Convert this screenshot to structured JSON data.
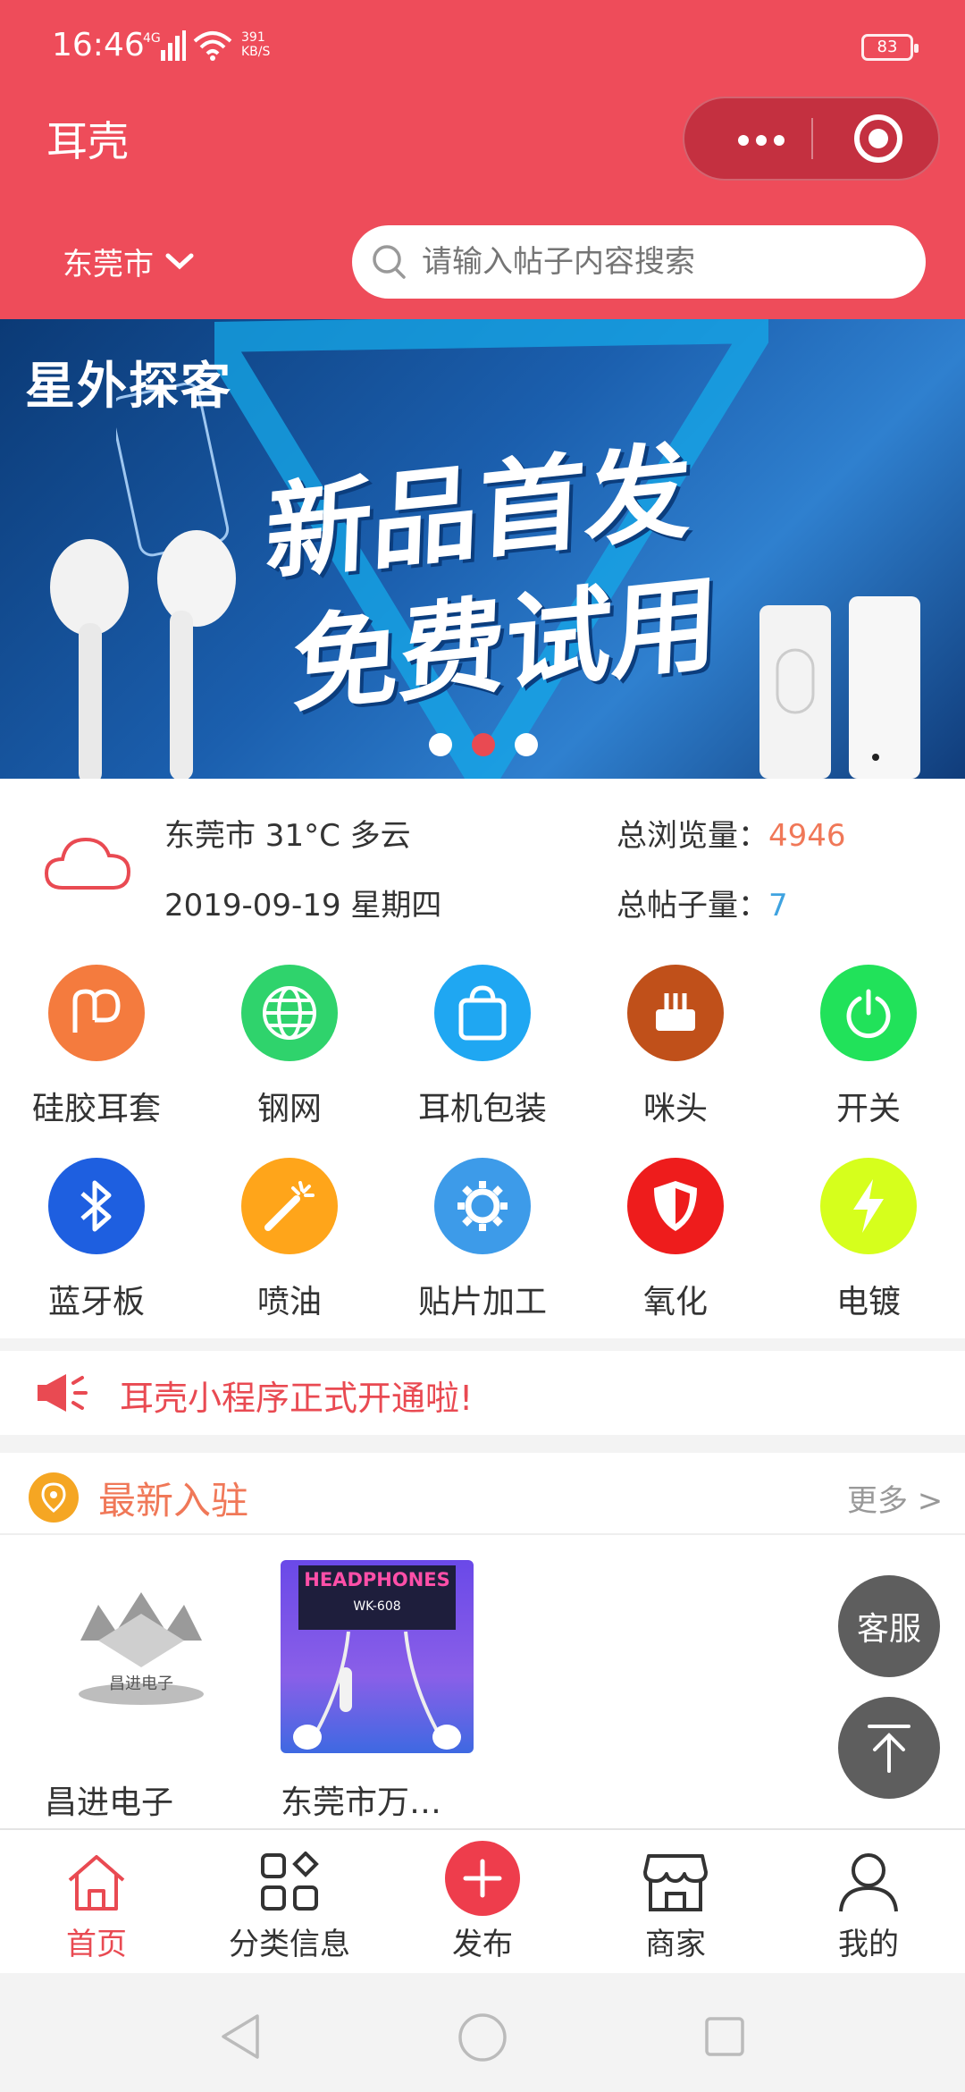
{
  "status_bar": {
    "time": "16:46",
    "network": "4G",
    "speed_value": "391",
    "speed_unit": "KB/S",
    "battery": "83"
  },
  "header": {
    "title": "耳壳",
    "city": "东莞市",
    "search_placeholder": "请输入帖子内容搜索"
  },
  "banner": {
    "brand": "星外探客",
    "headline_1": "新品首发",
    "headline_2": "免费试用",
    "active_dot": 1,
    "dot_count": 3
  },
  "info": {
    "weather": "东莞市 31°C 多云",
    "date": "2019-09-19 星期四",
    "views_label": "总浏览量：",
    "views_value": "4946",
    "posts_label": "总帖子量：",
    "posts_value": "7"
  },
  "categories": [
    {
      "label": "硅胶耳套",
      "icon": "earpad-icon",
      "color": "#f47b3e"
    },
    {
      "label": "钢网",
      "icon": "globe-icon",
      "color": "#2fd36c"
    },
    {
      "label": "耳机包装",
      "icon": "shopping-bag-icon",
      "color": "#1fa7f2"
    },
    {
      "label": "咪头",
      "icon": "router-icon",
      "color": "#c0501a"
    },
    {
      "label": "开关",
      "icon": "power-icon",
      "color": "#21e25a"
    },
    {
      "label": "蓝牙板",
      "icon": "bluetooth-icon",
      "color": "#1e5fe0"
    },
    {
      "label": "喷油",
      "icon": "magic-wand-icon",
      "color": "#ffa51a"
    },
    {
      "label": "贴片加工",
      "icon": "gear-icon",
      "color": "#3d9be9"
    },
    {
      "label": "氧化",
      "icon": "shield-icon",
      "color": "#ee1c1c"
    },
    {
      "label": "电镀",
      "icon": "lightning-icon",
      "color": "#d6ff1c"
    }
  ],
  "notice": {
    "text": "耳壳小程序正式开通啦!"
  },
  "latest": {
    "title": "最新入驻",
    "more": "更多 >",
    "shops": [
      {
        "name": "昌进电子",
        "logo_text": "昌进电子"
      },
      {
        "name": "东莞市万…",
        "logo_text": "HEADPHONES",
        "logo_sub": "WK-608"
      }
    ]
  },
  "float_buttons": {
    "service": "客服"
  },
  "tabbar": [
    {
      "label": "首页",
      "icon": "home-icon",
      "active": true
    },
    {
      "label": "分类信息",
      "icon": "category-icon",
      "active": false
    },
    {
      "label": "发布",
      "icon": "plus-icon",
      "active": false
    },
    {
      "label": "商家",
      "icon": "store-icon",
      "active": false
    },
    {
      "label": "我的",
      "icon": "user-icon",
      "active": false
    }
  ],
  "colors": {
    "brand": "#ee4c5a",
    "accent_orange": "#f07858",
    "accent_blue": "#3fa3e0"
  }
}
